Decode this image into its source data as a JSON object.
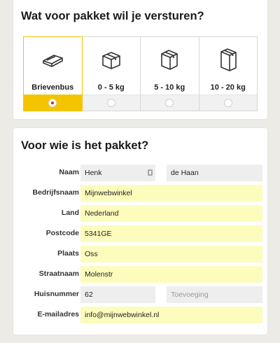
{
  "package_section": {
    "title": "Wat voor pakket wil je versturen?",
    "options": [
      {
        "label": "Brievenbus",
        "icon": "mailbox-package-icon",
        "selected": true
      },
      {
        "label": "0 - 5 kg",
        "icon": "small-box-icon",
        "selected": false
      },
      {
        "label": "5 - 10 kg",
        "icon": "medium-box-icon",
        "selected": false
      },
      {
        "label": "10 - 20 kg",
        "icon": "large-box-icon",
        "selected": false
      }
    ],
    "accent_color": "#f5c400",
    "radio_dot_color": "#d4242c"
  },
  "recipient_section": {
    "title": "Voor wie is het pakket?",
    "fields": {
      "naam": {
        "label": "Naam",
        "first": "Henk",
        "last": "de Haan",
        "icon": "contact-card-icon"
      },
      "bedrijfsnaam": {
        "label": "Bedrijfsnaam",
        "value": "Mijnwebwinkel"
      },
      "land": {
        "label": "Land",
        "value": "Nederland"
      },
      "postcode": {
        "label": "Postcode",
        "value": "5341GE"
      },
      "plaats": {
        "label": "Plaats",
        "value": "Oss"
      },
      "straatnaam": {
        "label": "Straatnaam",
        "value": "Molenstr"
      },
      "huisnummer": {
        "label": "Huisnummer",
        "value": "62",
        "toevoeging_placeholder": "Toevoeging"
      },
      "email": {
        "label": "E-mailadres",
        "value": "info@mijnwebwinkel.nl"
      }
    },
    "field_color_yellow": "#fcfcbd",
    "field_color_grey": "#eeeeee"
  }
}
